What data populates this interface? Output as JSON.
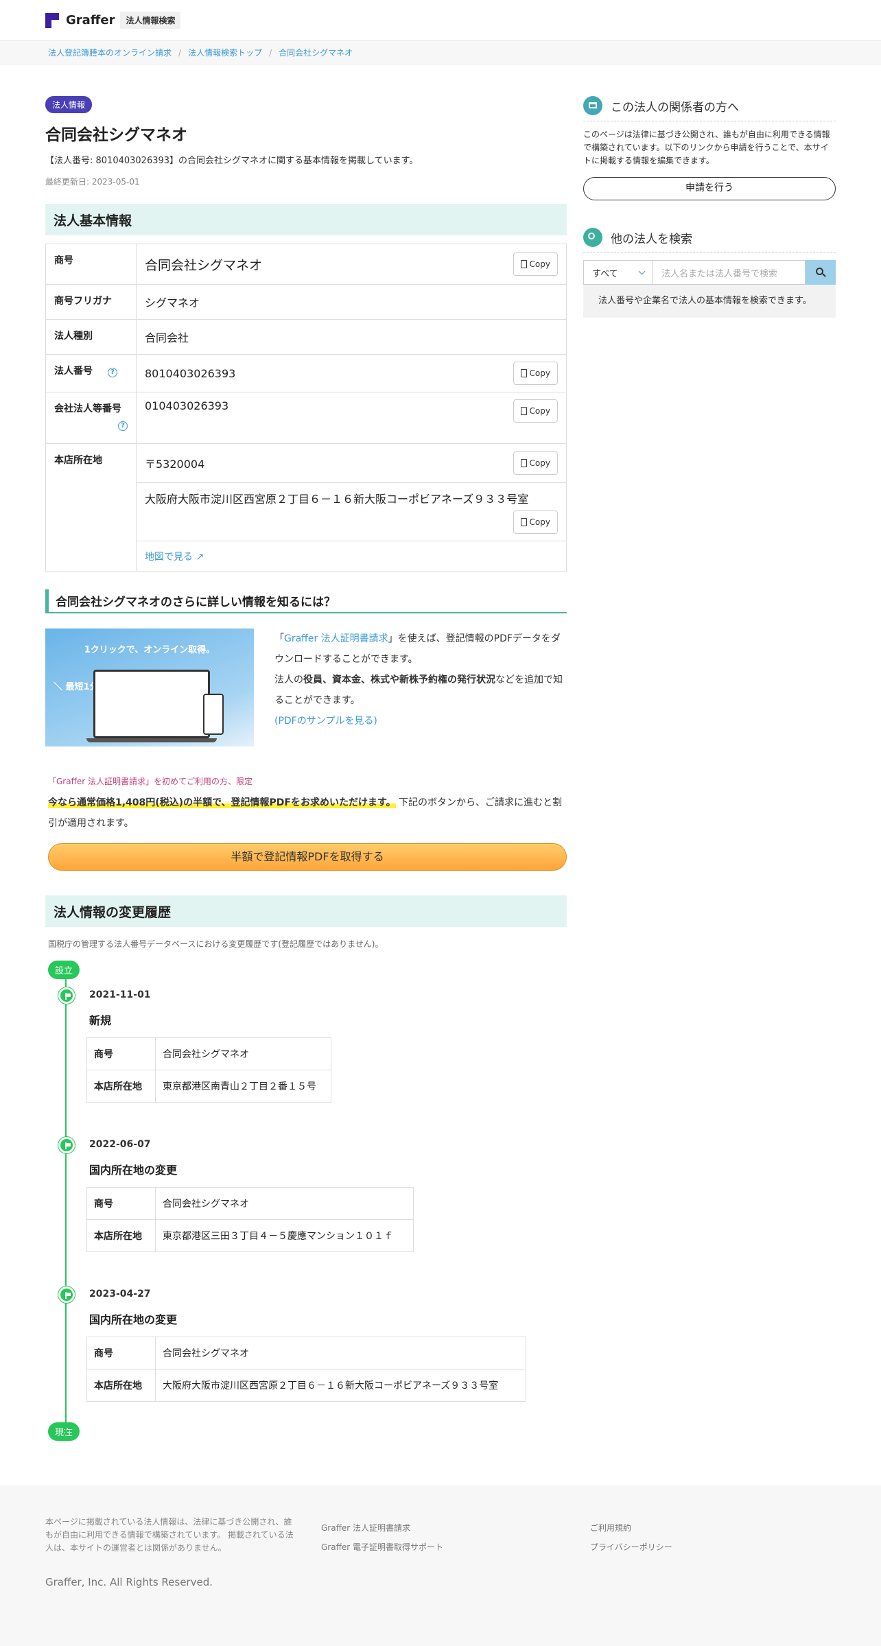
{
  "header": {
    "logo_text": "Graffer",
    "badge": "法人情報検索"
  },
  "breadcrumb": [
    "法人登記簿謄本のオンライン請求",
    "法人情報検索トップ",
    "合同会社シグマネオ"
  ],
  "tag": "法人情報",
  "title": "合同会社シグマネオ",
  "description": "【法人番号: 8010403026393】の合同会社シグマネオに関する基本情報を掲載しています。",
  "updated": "最終更新日: 2023-05-01",
  "basic": {
    "heading": "法人基本情報",
    "copy_label": "Copy",
    "rows": {
      "name_k": "商号",
      "name_v": "合同会社シグマネオ",
      "kana_k": "商号フリガナ",
      "kana_v": "シグマネオ",
      "type_k": "法人種別",
      "type_v": "合同会社",
      "num_k": "法人番号",
      "num_v": "8010403026393",
      "cnum_k": "会社法人等番号",
      "cnum_v": "010403026393",
      "addr_k": "本店所在地",
      "zip_v": "〒5320004",
      "addr_v": "大阪府大阪市淀川区西宮原２丁目６－１６新大阪コーポビアネーズ９３３号室",
      "map_v": "地図で見る"
    }
  },
  "more": {
    "title": "合同会社シグマネオのさらに詳しい情報を知るには？",
    "img_title": "1クリックで、オンライン取得。",
    "img_badge": "＼ 最短1分 ／",
    "p1_a": "「",
    "p1_link": "Graffer 法人証明書請求",
    "p1_b": "」を使えば、登記情報のPDFデータをダウンロードすることができます。",
    "p2_a": "法人の",
    "p2_bold": "役員、資本金、株式や新株予約権の発行状況",
    "p2_b": "などを追加で知ることができます。",
    "sample": "(PDFのサンプルを見る)",
    "offer_small": "「Graffer 法人証明書請求」を初めてご利用の方、限定",
    "offer_hl": "今なら通常価格1,408円(税込)の半額で、登記情報PDFをお求めいただけます。",
    "offer_rest": "下記のボタンから、ご請求に進むと割引が適用されます。",
    "cta": "半額で登記情報PDFを取得する"
  },
  "history": {
    "heading": "法人情報の変更履歴",
    "note": "国税庁の管理する法人番号データベースにおける変更履歴です(登記履歴ではありません)。",
    "start": "設立",
    "end": "現在",
    "events": [
      {
        "date": "2021-11-01",
        "type": "新規",
        "name_k": "商号",
        "name_v": "合同会社シグマネオ",
        "addr_k": "本店所在地",
        "addr_v": "東京都港区南青山２丁目２番１５号"
      },
      {
        "date": "2022-06-07",
        "type": "国内所在地の変更",
        "name_k": "商号",
        "name_v": "合同会社シグマネオ",
        "addr_k": "本店所在地",
        "addr_v": "東京都港区三田３丁目４－５慶應マンション１０１ｆ"
      },
      {
        "date": "2023-04-27",
        "type": "国内所在地の変更",
        "name_k": "商号",
        "name_v": "合同会社シグマネオ",
        "addr_k": "本店所在地",
        "addr_v": "大阪府大阪市淀川区西宮原２丁目６－１６新大阪コーポビアネーズ９３３号室"
      }
    ]
  },
  "side": {
    "rel_title": "この法人の関係者の方へ",
    "rel_text": "このページは法律に基づき公開され、誰もが自由に利用できる情報で構築されています。以下のリンクから申請を行うことで、本サイトに掲載する情報を編集できます。",
    "apply": "申請を行う",
    "search_title": "他の法人を検索",
    "select": "すべて",
    "placeholder": "法人名または法人番号で検索",
    "hint": "法人番号や企業名で法人の基本情報を検索できます。"
  },
  "footer": {
    "note": "本ページに掲載されている法人情報は、法律に基づき公開され、誰もが自由に利用できる情報で構築されています。 掲載されている法人は、本サイトの運営者とは関係がありません。",
    "copyright": "Graffer, Inc. All Rights Reserved.",
    "links1": [
      "Graffer 法人証明書請求",
      "Graffer 電子証明書取得サポート"
    ],
    "links2": [
      "ご利用規約",
      "プライバシーポリシー"
    ]
  },
  "colors": {
    "accent": "#4a3fb5",
    "teal": "#e1f4f1",
    "green": "#28c75a",
    "link": "#3b9ad6",
    "cta": "#ffa53a"
  }
}
